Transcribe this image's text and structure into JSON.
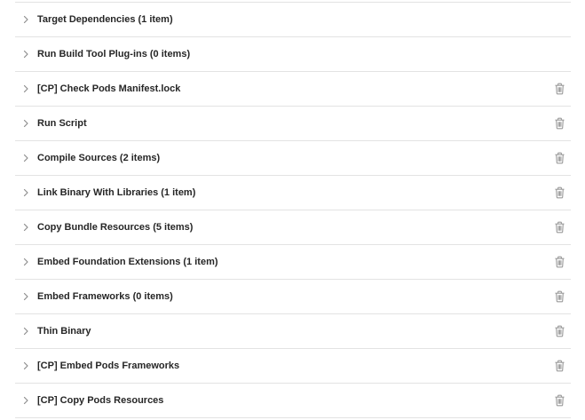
{
  "phases": [
    {
      "label": "Target Dependencies (1 item)",
      "deletable": false
    },
    {
      "label": "Run Build Tool Plug-ins (0 items)",
      "deletable": false
    },
    {
      "label": "[CP] Check Pods Manifest.lock",
      "deletable": true
    },
    {
      "label": "Run Script",
      "deletable": true
    },
    {
      "label": "Compile Sources (2 items)",
      "deletable": true
    },
    {
      "label": "Link Binary With Libraries (1 item)",
      "deletable": true
    },
    {
      "label": "Copy Bundle Resources (5 items)",
      "deletable": true
    },
    {
      "label": "Embed Foundation Extensions (1 item)",
      "deletable": true
    },
    {
      "label": "Embed Frameworks (0 items)",
      "deletable": true
    },
    {
      "label": "Thin Binary",
      "deletable": true
    },
    {
      "label": "[CP] Embed Pods Frameworks",
      "deletable": true
    },
    {
      "label": "[CP] Copy Pods Resources",
      "deletable": true
    }
  ],
  "icons": {
    "expand": "chevron-right-icon",
    "delete": "trash-icon"
  },
  "colors": {
    "text": "#262626",
    "separator": "#e3e3e3",
    "icon": "#9a9a9a"
  }
}
